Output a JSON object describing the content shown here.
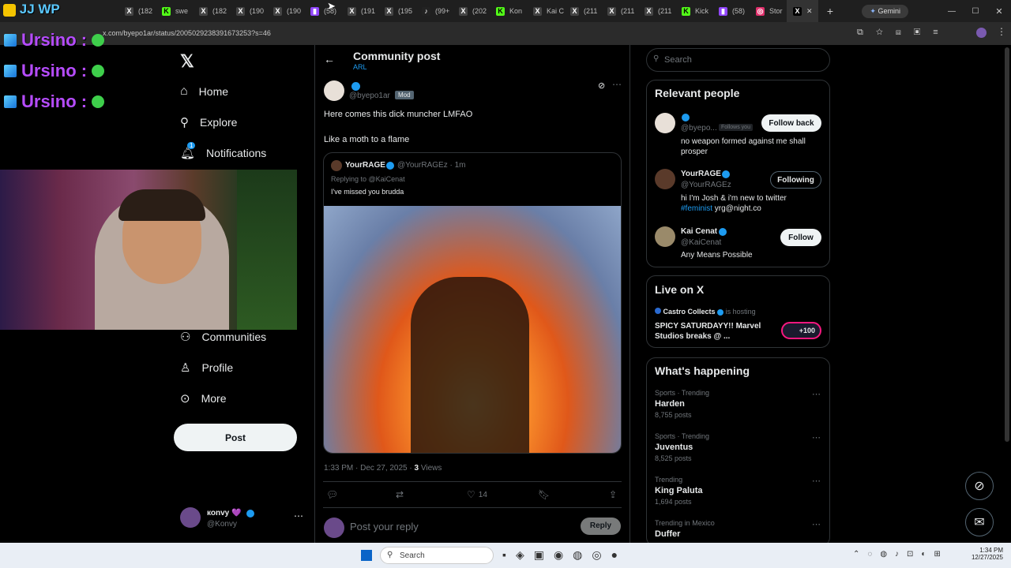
{
  "browser": {
    "tabs": [
      {
        "label": "(182",
        "icon": "x-icon"
      },
      {
        "label": "swe",
        "icon": "kick-icon"
      },
      {
        "label": "(182",
        "icon": "x-icon"
      },
      {
        "label": "(190",
        "icon": "x-icon"
      },
      {
        "label": "(190",
        "icon": "x-icon"
      },
      {
        "label": "(58)",
        "icon": "twitch-icon"
      },
      {
        "label": "(191",
        "icon": "x-icon"
      },
      {
        "label": "(195",
        "icon": "x-icon"
      },
      {
        "label": "(99+",
        "icon": "tiktok-icon"
      },
      {
        "label": "(202",
        "icon": "x-icon"
      },
      {
        "label": "Kon",
        "icon": "kick-icon"
      },
      {
        "label": "Kai C",
        "icon": "x-icon"
      },
      {
        "label": "(211",
        "icon": "x-icon"
      },
      {
        "label": "(211",
        "icon": "x-icon"
      },
      {
        "label": "(211",
        "icon": "x-icon"
      },
      {
        "label": "Kick",
        "icon": "kick-icon"
      },
      {
        "label": "(58)",
        "icon": "twitch-icon"
      },
      {
        "label": "Stor",
        "icon": "instagram-icon"
      }
    ],
    "gemini_label": "Gemini",
    "url": "x.com/byepo1ar/status/2005029238391673253?s=46"
  },
  "overlay": {
    "logo_text": "JJ WP",
    "names": [
      "Ursino :",
      "Ursino :",
      "Ursino :"
    ]
  },
  "nav": {
    "items": [
      {
        "label": "Home",
        "icon": "home-icon"
      },
      {
        "label": "Explore",
        "icon": "search-icon"
      },
      {
        "label": "Notifications",
        "icon": "bell-icon"
      },
      {
        "label": "Communities",
        "icon": "communities-icon"
      },
      {
        "label": "Profile",
        "icon": "profile-icon"
      },
      {
        "label": "More",
        "icon": "more-icon"
      }
    ],
    "notif_badge": "1",
    "post_label": "Post",
    "account": {
      "name": "коnvy 💜",
      "handle": "@Konvy"
    }
  },
  "post": {
    "header_title": "Community post",
    "header_sub": "ARL",
    "author_handle": "@byepo1ar",
    "mod_badge": "Mod",
    "text_line1": "Here comes this dick muncher LMFAO",
    "text_line2": "Like a moth to a flame",
    "quote": {
      "name": "YourRAGE",
      "handle": "@YourRAGEz · 1m",
      "replying": "Replying to @KaiCenat",
      "text": "I've missed you brudda"
    },
    "timestamp": "1:33 PM · Dec 27, 2025 · ",
    "views_count": "3",
    "views_label": " Views",
    "likes": "14",
    "reply_placeholder": "Post your reply",
    "reply_button": "Reply"
  },
  "sidebar": {
    "search_placeholder": "Search",
    "relevant_title": "Relevant people",
    "people": [
      {
        "name": "",
        "handle": "@byepo...",
        "follows_you": "Follows you",
        "bio": "no weapon formed against me shall prosper",
        "button": "Follow back"
      },
      {
        "name": "YourRAGE",
        "handle": "@YourRAGEz",
        "bio_prefix": "hi I'm Josh & i'm new to twitter ",
        "bio_tag": "#feminist",
        "bio_suffix": " yrg@night.co",
        "button": "Following"
      },
      {
        "name": "Kai Cenat",
        "handle": "@KaiCenat",
        "bio": "Any Means Possible",
        "button": "Follow"
      }
    ],
    "live_title": "Live on X",
    "live": {
      "host": "Castro Collects",
      "hosting": "is hosting",
      "title": "SPICY SATURDAYY!! Marvel Studios breaks @ ...",
      "count": "+100"
    },
    "happening_title": "What's happening",
    "trends": [
      {
        "meta": "Sports · Trending",
        "name": "Harden",
        "count": "8,755 posts"
      },
      {
        "meta": "Sports · Trending",
        "name": "Juventus",
        "count": "8,525 posts"
      },
      {
        "meta": "Trending",
        "name": "King Paluta",
        "count": "1,694 posts"
      },
      {
        "meta": "Trending in Mexico",
        "name": "Duffer",
        "count": ""
      }
    ]
  },
  "taskbar": {
    "search_placeholder": "Search",
    "time": "1:34 PM",
    "date": "12/27/2025"
  }
}
